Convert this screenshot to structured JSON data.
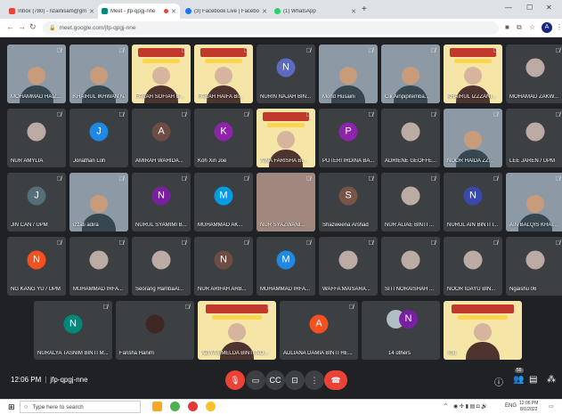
{
  "browser": {
    "tabs": [
      {
        "title": "Inbox (780) - nzainisam@gmail...",
        "icon": "gmail-icon",
        "color": "#ea4335",
        "active": false
      },
      {
        "title": "Meet - jfp-qpgj-nne",
        "icon": "meet-icon",
        "color": "#00897b",
        "active": true
      },
      {
        "title": "(3) Facebook Live | Facebook",
        "icon": "facebook-icon",
        "color": "#1877f2",
        "active": false
      },
      {
        "title": "(1) WhatsApp",
        "icon": "whatsapp-icon",
        "color": "#25d366",
        "active": false
      }
    ],
    "url": "meet.google.com/jfp-qpgj-nne",
    "profile_initial": "A"
  },
  "meeting": {
    "time": "12:06 PM",
    "code": "jfp-qpgj-nne",
    "participants_badge": "55",
    "others_label": "14 others",
    "others_initial": "N"
  },
  "participants": [
    {
      "name": "MOHAMMAD HAIZ...",
      "initial": "",
      "color": "#8b8b8b"
    },
    {
      "name": "KHAIRUL IKHWAN NAGUIB...",
      "initial": "",
      "color": "#8b8b8b"
    },
    {
      "name": "FARAH SOFIAH B...",
      "initial": "",
      "color": "#8b8b8b"
    },
    {
      "name": "FARAH HAIFA Bi...",
      "initial": "",
      "color": "#8b8b8b"
    },
    {
      "name": "NURIN NAJAH BIN...",
      "initial": "N",
      "color": "#5c6bc0"
    },
    {
      "name": "Mohd Husaini",
      "initial": "",
      "color": "#8b8b8b"
    },
    {
      "name": "Cik Ainpipitemba...",
      "initial": "",
      "color": "#8b8b8b"
    },
    {
      "name": "KHAIRUL IZZZANI...",
      "initial": "",
      "color": "#8b8b8b"
    },
    {
      "name": "MOHAMAD ZAKW...",
      "initial": "",
      "color": "#8b8b8b"
    },
    {
      "name": "NUR AMYLIA",
      "initial": "",
      "color": "#8b8b8b"
    },
    {
      "name": "Jonathan Loh",
      "initial": "J",
      "color": "#1e88e5"
    },
    {
      "name": "AMIRAH WAHIDA...",
      "initial": "A",
      "color": "#6d4c41"
    },
    {
      "name": "Koh Xin Joe",
      "initial": "K",
      "color": "#8e24aa"
    },
    {
      "name": "AINA FARISHA BI...",
      "initial": "",
      "color": "#8b8b8b"
    },
    {
      "name": "PUTERI IRDINA BA...",
      "initial": "P",
      "color": "#8e24aa"
    },
    {
      "name": "ADRIENE GEOFFE...",
      "initial": "",
      "color": "#8b8b8b"
    },
    {
      "name": "NOOR HAIDA ZZ...",
      "initial": "",
      "color": "#8b8b8b"
    },
    {
      "name": "LEE JAREN / UPM",
      "initial": "",
      "color": "#8b8b8b"
    },
    {
      "name": "JIN CAN / UPM",
      "initial": "J",
      "color": "#546e7a"
    },
    {
      "name": "izzati adira",
      "initial": "",
      "color": "#8b8b8b"
    },
    {
      "name": "NURUL SYAMIMI B...",
      "initial": "N",
      "color": "#7b1fa2"
    },
    {
      "name": "MUHAMMAD AK...",
      "initial": "M",
      "color": "#039be5"
    },
    {
      "name": "NUR SYAZWANI...",
      "initial": "",
      "color": "#8b8b8b"
    },
    {
      "name": "Shazweena Arshad",
      "initial": "S",
      "color": "#795548"
    },
    {
      "name": "NUR ALIAE BINTI ...",
      "initial": "",
      "color": "#8b8b8b"
    },
    {
      "name": "NURUL AIN BINTI I...",
      "initial": "N",
      "color": "#3949ab"
    },
    {
      "name": "AIN BALQIS KHAI...",
      "initial": "",
      "color": "#8b8b8b"
    },
    {
      "name": "NG KANG YU / UPM",
      "initial": "N",
      "color": "#f4511e"
    },
    {
      "name": "MUHAMMAD IRFA...",
      "initial": "",
      "color": "#8b8b8b"
    },
    {
      "name": "Seorang HambaAl...",
      "initial": "",
      "color": "#8b8b8b"
    },
    {
      "name": "NUR ARIFAH ARB...",
      "initial": "N",
      "color": "#6d4c41"
    },
    {
      "name": "MUHAMMAD IRFA...",
      "initial": "M",
      "color": "#1e88e5"
    },
    {
      "name": "WAFFA MAISARA...",
      "initial": "",
      "color": "#8b8b8b"
    },
    {
      "name": "SITI NORAISHAH ...",
      "initial": "",
      "color": "#8b8b8b"
    },
    {
      "name": "NOOR IDAYU BIN...",
      "initial": "",
      "color": "#8b8b8b"
    },
    {
      "name": "Ngaishu 06",
      "initial": "",
      "color": "#8b8b8b"
    },
    {
      "name": "NURALYA TASNIM BINTI M...",
      "initial": "N",
      "color": "#00897b"
    },
    {
      "name": "Farisha Hanim",
      "initial": "",
      "color": "#5d4037"
    },
    {
      "name": "AZIYA EMELDA BINTI NO...",
      "initial": "",
      "color": "#8b8b8b"
    },
    {
      "name": "ADLIANA DAMIA BINTI HE...",
      "initial": "A",
      "color": "#f4511e"
    },
    {
      "name": "You",
      "initial": "",
      "color": "#8b8b8b"
    }
  ],
  "taskbar": {
    "search_placeholder": "Type here to search",
    "clock_time": "12:06 PM",
    "clock_date": "8/1/2022",
    "lang": "ENG"
  }
}
